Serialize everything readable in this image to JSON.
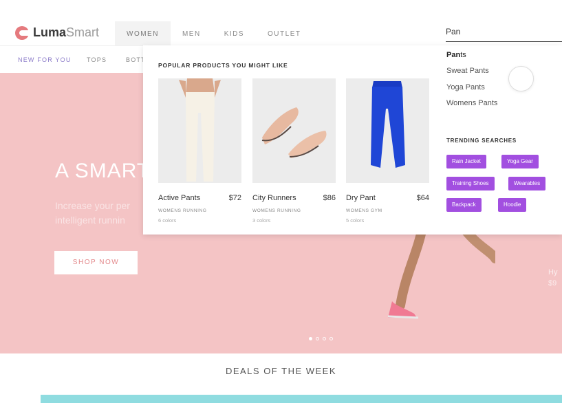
{
  "brand": {
    "name_bold": "Luma",
    "name_light": "Smart"
  },
  "main_nav": [
    "WOMEN",
    "MEN",
    "KIDS",
    "OUTLET"
  ],
  "search": {
    "value": "Pan",
    "placeholder": ""
  },
  "sub_nav": [
    "NEW FOR YOU",
    "TOPS",
    "BOTT"
  ],
  "hero": {
    "title": "A SMART",
    "subtitle_line1": "Increase your per",
    "subtitle_line2": "intelligent runnin",
    "cta": "SHOP NOW",
    "side_name": "Hy",
    "side_price": "$9"
  },
  "dropdown": {
    "heading": "POPULAR PRODUCTS YOU MIGHT LIKE",
    "products": [
      {
        "name": "Active Pants",
        "price": "$72",
        "category": "WOMENS RUNNING",
        "colors": "6 colors"
      },
      {
        "name": "City Runners",
        "price": "$86",
        "category": "WOMENS RUNNING",
        "colors": "3 colors"
      },
      {
        "name": "Dry Pant",
        "price": "$64",
        "category": "WOMENS GYM",
        "colors": "5 colors"
      }
    ],
    "suggestions": [
      {
        "match": "Pan",
        "rest": "ts"
      },
      {
        "label": "Sweat Pants"
      },
      {
        "label": "Yoga Pants"
      },
      {
        "label": "Womens Pants"
      }
    ],
    "trending_heading": "TRENDING SEARCHES",
    "trending": [
      "Rain Jacket",
      "Yoga Gear",
      "Training Shoes",
      "Wearables",
      "Backpack",
      "Hoodie"
    ]
  },
  "deals": {
    "title": "DEALS OF THE WEEK"
  },
  "colors": {
    "hero_bg": "#f4c4c5",
    "accent_purple": "#a24fe0",
    "subnav_active": "#8b7bc9",
    "logo": "#e57a7e",
    "deals_bar": "#8fdce0"
  }
}
